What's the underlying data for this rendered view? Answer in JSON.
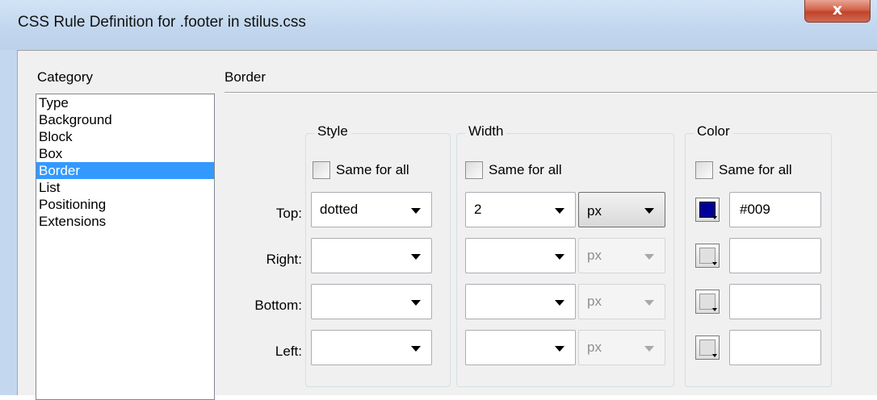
{
  "window": {
    "title": "CSS Rule Definition for .footer in stilus.css",
    "close_glyph": "x"
  },
  "category": {
    "label": "Category",
    "items": [
      "Type",
      "Background",
      "Block",
      "Box",
      "Border",
      "List",
      "Positioning",
      "Extensions"
    ],
    "selected": "Border"
  },
  "section": {
    "title": "Border"
  },
  "groups": {
    "style": "Style",
    "width": "Width",
    "color": "Color"
  },
  "same_for_all": "Same for all",
  "rows": {
    "top": {
      "label": "Top:",
      "style": "dotted",
      "width": "2",
      "unit": "px",
      "color": "#009",
      "swatch_color": "#000099",
      "unit_enabled": true
    },
    "right": {
      "label": "Right:",
      "style": "",
      "width": "",
      "unit": "px",
      "color": "",
      "unit_enabled": false
    },
    "bottom": {
      "label": "Bottom:",
      "style": "",
      "width": "",
      "unit": "px",
      "color": "",
      "unit_enabled": false
    },
    "left": {
      "label": "Left:",
      "style": "",
      "width": "",
      "unit": "px",
      "color": "",
      "unit_enabled": false
    }
  },
  "icons": {
    "close": "close-icon",
    "dropdown": "chevron-down-icon",
    "color_picker": "color-picker-icon"
  }
}
